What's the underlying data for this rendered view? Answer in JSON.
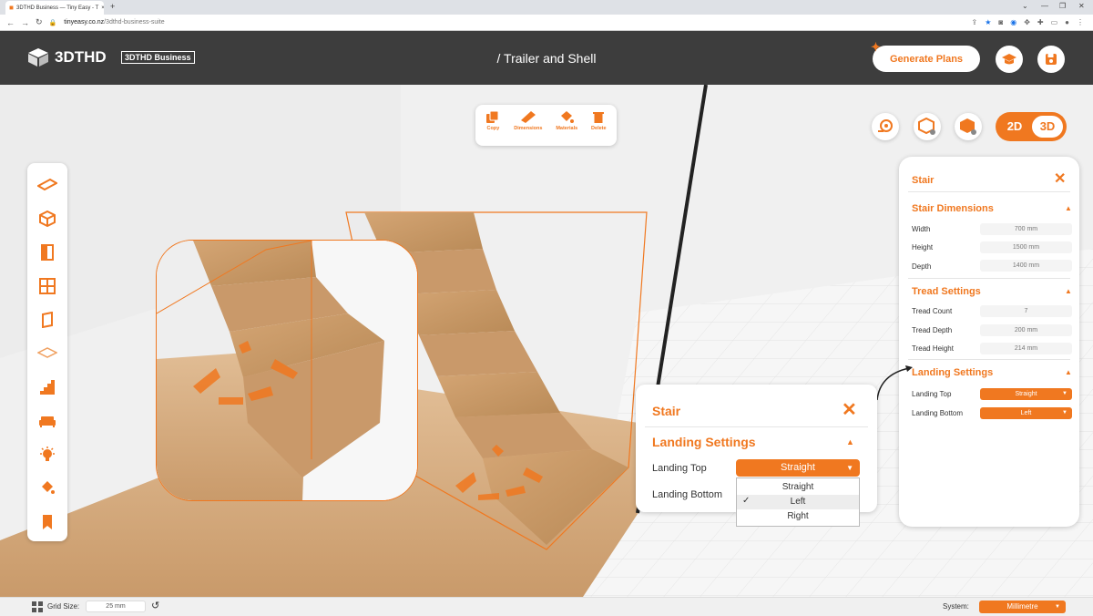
{
  "browser": {
    "tab_title": "3DTHD Business — Tiny Easy - T",
    "url_host": "tinyeasy.co.nz",
    "url_path": "/3dthd-business-suite",
    "new_tab": "+",
    "min": "—",
    "restore": "❐",
    "close": "✕",
    "chevron": "⌄"
  },
  "header": {
    "logo_text": "3DTHD",
    "badge": "3DTHD Business",
    "title": "/ Trailer and Shell",
    "generate_label": "Generate Plans"
  },
  "actions": [
    {
      "label": "Copy",
      "icon": "copy-icon"
    },
    {
      "label": "Dimensions",
      "icon": "ruler-icon"
    },
    {
      "label": "Materials",
      "icon": "paint-bucket-icon"
    },
    {
      "label": "Delete",
      "icon": "trash-icon"
    }
  ],
  "view_toggle": {
    "two_d": "2D",
    "three_d": "3D"
  },
  "panel": {
    "title": "Stair",
    "dimensions": {
      "heading": "Stair Dimensions",
      "width_label": "Width",
      "width_value": "700 mm",
      "height_label": "Height",
      "height_value": "1500 mm",
      "depth_label": "Depth",
      "depth_value": "1400 mm"
    },
    "tread": {
      "heading": "Tread Settings",
      "count_label": "Tread Count",
      "count_value": "7",
      "depth_label": "Tread Depth",
      "depth_value": "200 mm",
      "height_label": "Tread Height",
      "height_value": "214 mm"
    },
    "landing": {
      "heading": "Landing Settings",
      "top_label": "Landing Top",
      "top_value": "Straight",
      "bottom_label": "Landing Bottom",
      "bottom_value": "Left"
    }
  },
  "zoom_panel": {
    "title": "Stair",
    "heading": "Landing Settings",
    "top_label": "Landing Top",
    "top_value": "Straight",
    "bottom_label": "Landing Bottom",
    "options": [
      "Straight",
      "Left",
      "Right"
    ],
    "selected_mark": "✓"
  },
  "bottom": {
    "grid_label": "Grid Size:",
    "grid_value": "25 mm",
    "system_label": "System:",
    "system_value": "Millimetre"
  },
  "colors": {
    "accent": "#f07820",
    "header": "#3d3d3d"
  }
}
